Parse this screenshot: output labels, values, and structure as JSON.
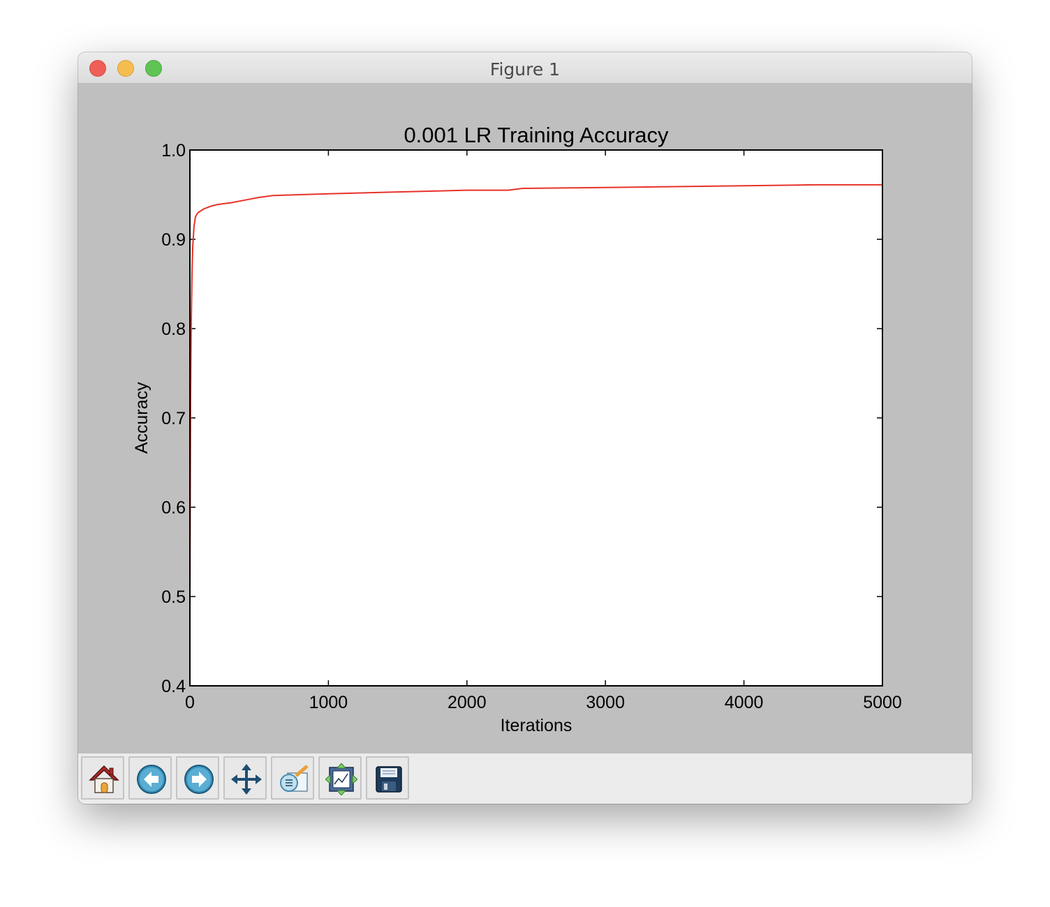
{
  "window": {
    "title": "Figure 1"
  },
  "toolbar": {
    "buttons": [
      {
        "name": "home-button",
        "icon": "home-icon"
      },
      {
        "name": "back-button",
        "icon": "back-arrow-icon"
      },
      {
        "name": "forward-button",
        "icon": "forward-arrow-icon"
      },
      {
        "name": "pan-button",
        "icon": "move-icon"
      },
      {
        "name": "zoom-button",
        "icon": "zoom-rect-icon"
      },
      {
        "name": "subplots-button",
        "icon": "subplots-icon"
      },
      {
        "name": "save-button",
        "icon": "floppy-disk-icon"
      }
    ]
  },
  "colors": {
    "line": "#e8322a",
    "figure_bg": "#bfbfbf",
    "axes_bg": "#ffffff"
  },
  "chart_data": {
    "type": "line",
    "title": "0.001 LR Training Accuracy",
    "xlabel": "Iterations",
    "ylabel": "Accuracy",
    "xlim": [
      0,
      5000
    ],
    "ylim": [
      0.4,
      1.0
    ],
    "xticks": [
      0,
      1000,
      2000,
      3000,
      4000,
      5000
    ],
    "xtick_labels": [
      "0",
      "1000",
      "2000",
      "3000",
      "4000",
      "5000"
    ],
    "yticks": [
      0.4,
      0.5,
      0.6,
      0.7,
      0.8,
      0.9,
      1.0
    ],
    "ytick_labels": [
      "0.4",
      "0.5",
      "0.6",
      "0.7",
      "0.8",
      "0.9",
      "1.0"
    ],
    "grid": false,
    "series": [
      {
        "color": "#e8322a",
        "x": [
          0,
          5,
          10,
          15,
          20,
          30,
          40,
          50,
          60,
          80,
          100,
          150,
          200,
          300,
          400,
          500,
          600,
          800,
          1000,
          1500,
          2000,
          2300,
          2400,
          3000,
          3500,
          4000,
          4500,
          5000
        ],
        "y": [
          0.5,
          0.72,
          0.81,
          0.86,
          0.89,
          0.915,
          0.925,
          0.928,
          0.93,
          0.932,
          0.934,
          0.937,
          0.939,
          0.941,
          0.944,
          0.947,
          0.949,
          0.95,
          0.951,
          0.953,
          0.955,
          0.955,
          0.957,
          0.958,
          0.959,
          0.96,
          0.961,
          0.961
        ]
      }
    ]
  }
}
